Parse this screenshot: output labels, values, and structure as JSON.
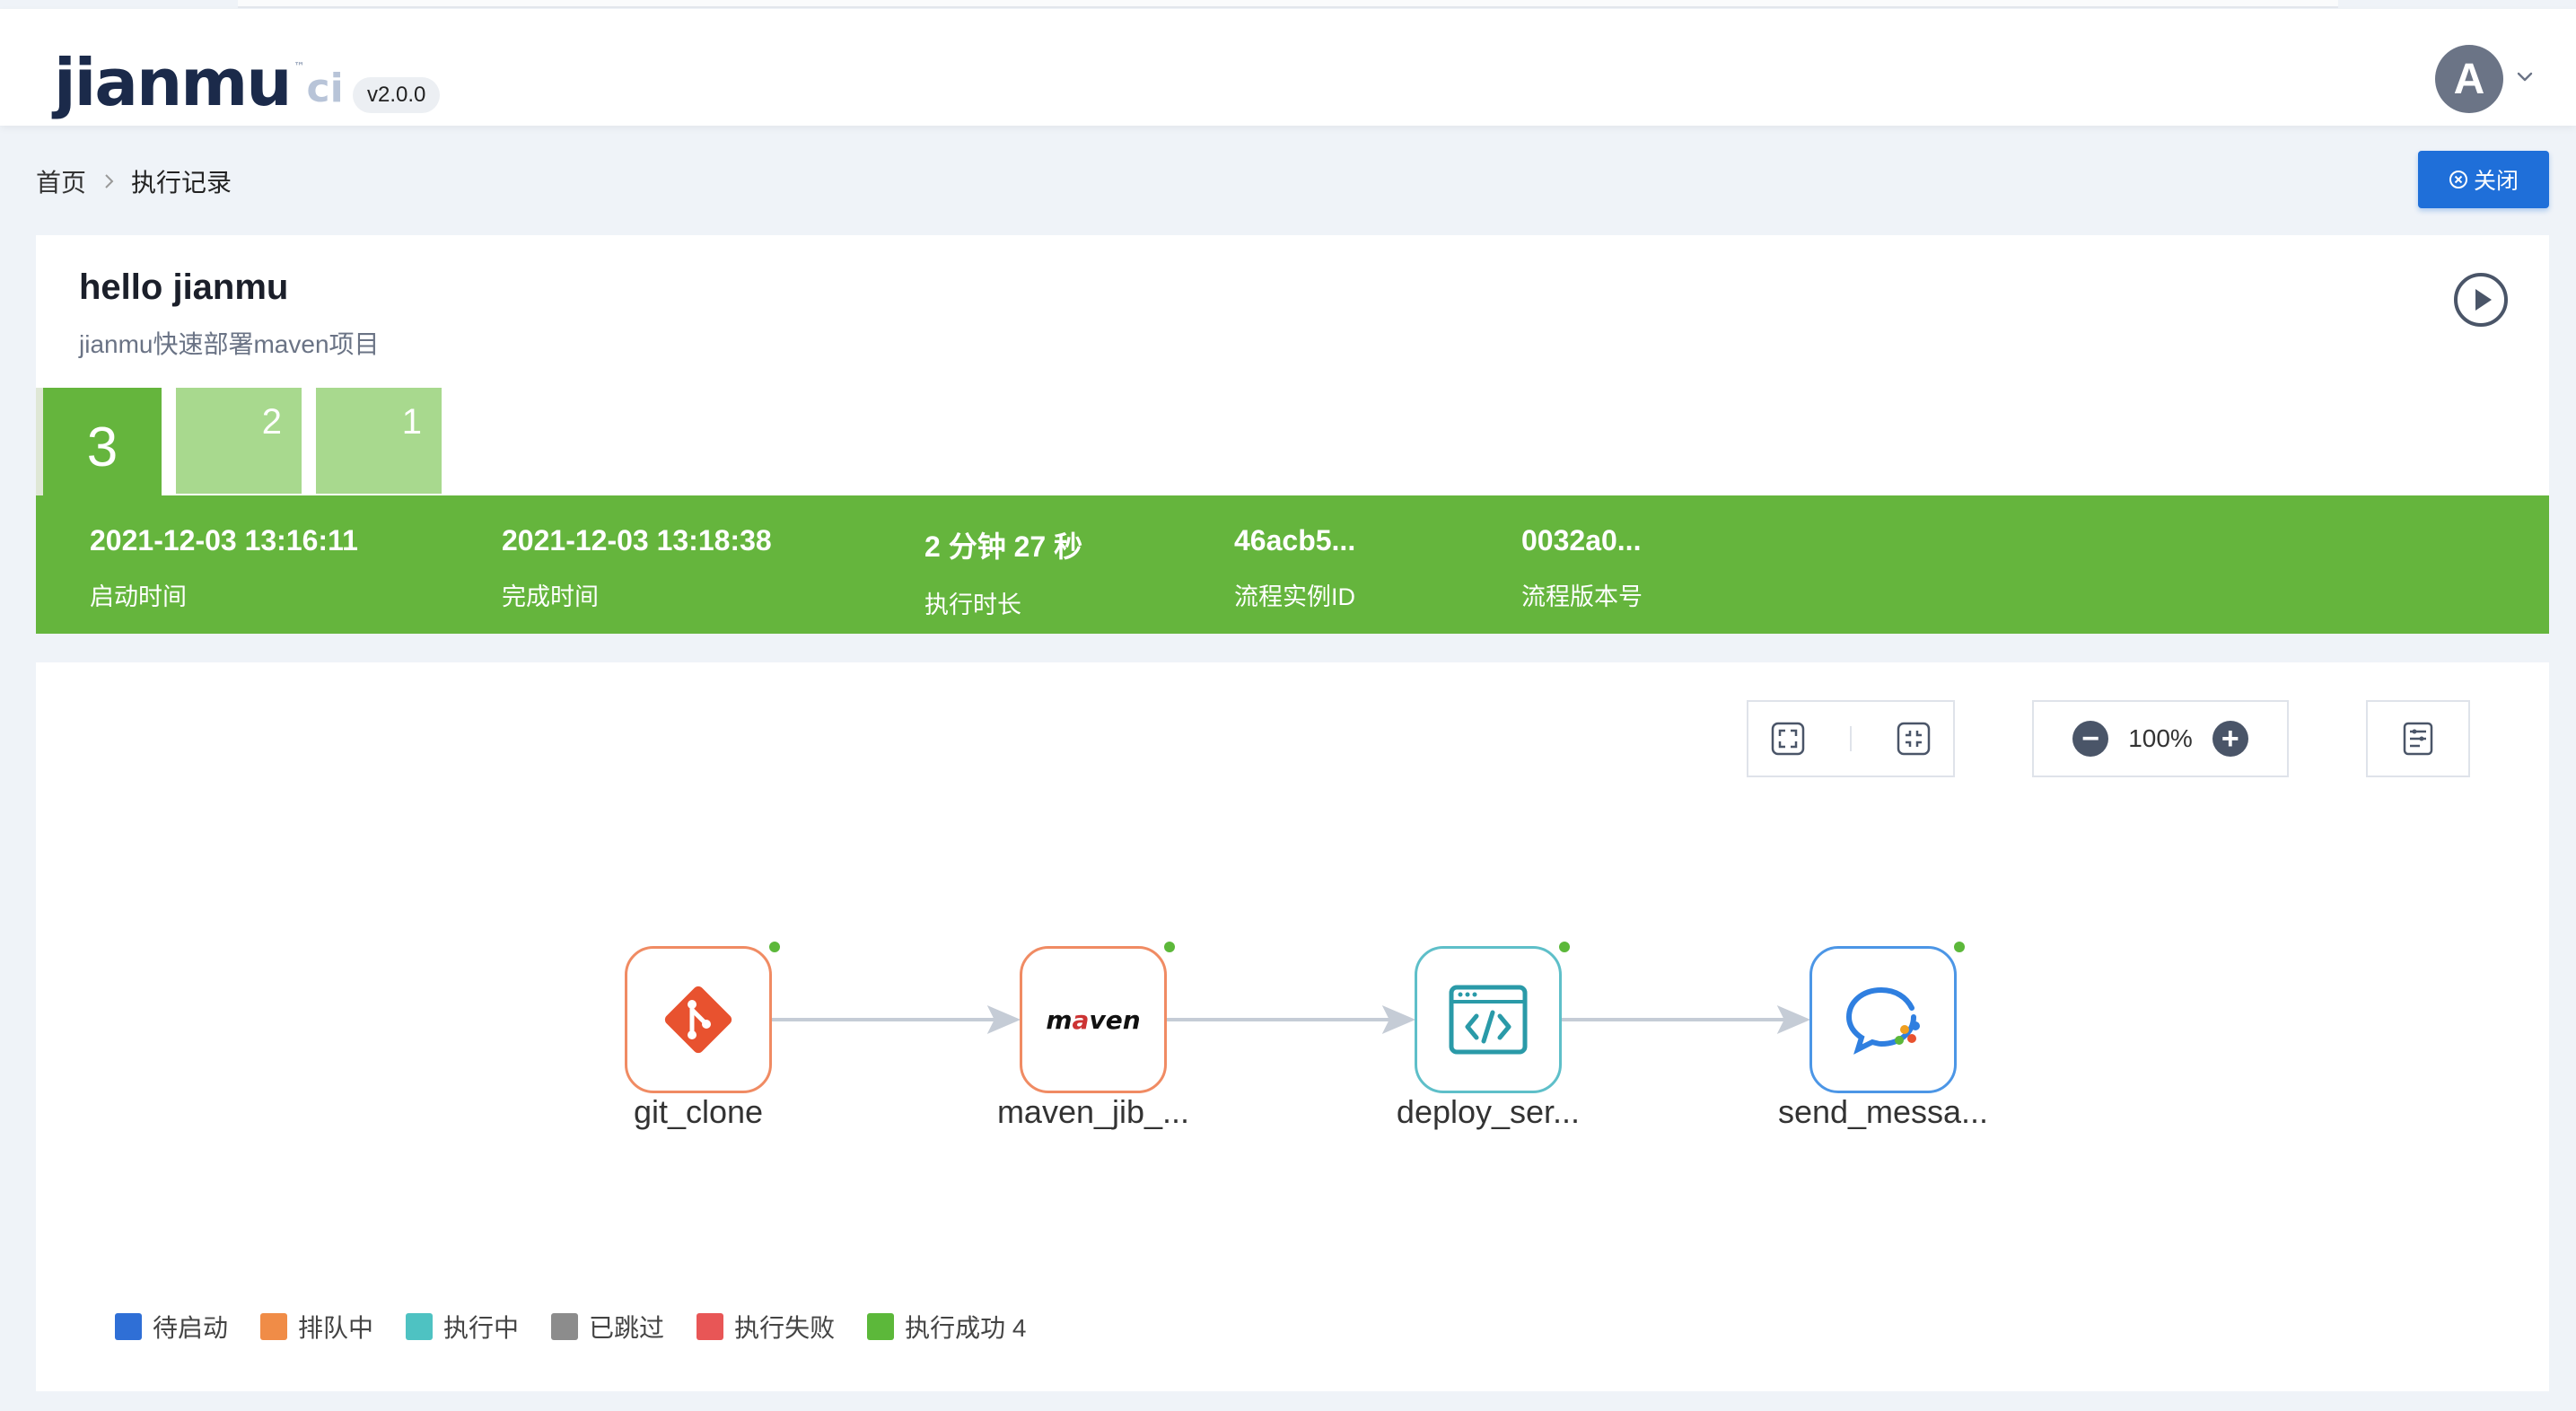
{
  "header": {
    "logo_text": "jianmu",
    "logo_suffix": "ci",
    "version": "v2.0.0",
    "avatar_letter": "A"
  },
  "breadcrumb": {
    "home": "首页",
    "current": "执行记录"
  },
  "close_button": {
    "label": "关闭"
  },
  "workflow": {
    "name": "hello jianmu",
    "description": "jianmu快速部署maven项目",
    "records": [
      "3",
      "2",
      "1"
    ],
    "active_record": "3"
  },
  "execution": {
    "start_time": "2021-12-03 13:16:11",
    "start_label": "启动时间",
    "end_time": "2021-12-03 13:18:38",
    "end_label": "完成时间",
    "duration": "2 分钟 27 秒",
    "duration_label": "执行时长",
    "instance_id": "46acb5...",
    "instance_label": "流程实例ID",
    "version_id": "0032a0...",
    "version_label": "流程版本号"
  },
  "toolbar": {
    "zoom": "100%"
  },
  "nodes": [
    {
      "label": "git_clone",
      "icon": "git-icon"
    },
    {
      "label": "maven_jib_...",
      "icon": "maven-icon"
    },
    {
      "label": "deploy_ser...",
      "icon": "code-window-icon"
    },
    {
      "label": "send_messa...",
      "icon": "chat-icon"
    }
  ],
  "legend": [
    {
      "label": "待启动",
      "color": "#2f6fd6"
    },
    {
      "label": "排队中",
      "color": "#f08c47"
    },
    {
      "label": "执行中",
      "color": "#4ec2c2"
    },
    {
      "label": "已跳过",
      "color": "#8c8c8c"
    },
    {
      "label": "执行失败",
      "color": "#e85656"
    },
    {
      "label": "执行成功 4",
      "color": "#5cb83a"
    }
  ],
  "colors": {
    "success": "#65b53d",
    "success_light": "#a8d98e",
    "primary": "#1f6fd9"
  }
}
